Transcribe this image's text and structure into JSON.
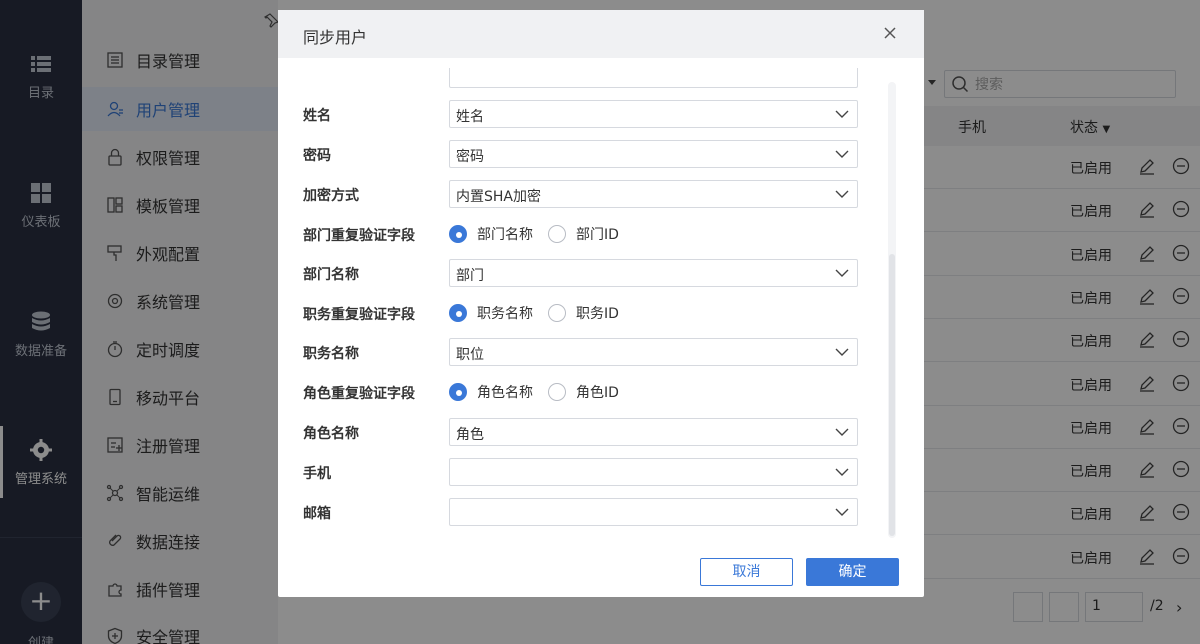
{
  "rail": {
    "items": [
      {
        "label": "目录",
        "icon": "list-icon"
      },
      {
        "label": "仪表板",
        "icon": "dashboard-icon"
      },
      {
        "label": "数据准备",
        "icon": "database-icon"
      },
      {
        "label": "管理系统",
        "icon": "gear-icon",
        "active": true
      }
    ],
    "add_label": "创建"
  },
  "menu": {
    "items": [
      {
        "label": "目录管理",
        "icon": "catalog-icon"
      },
      {
        "label": "用户管理",
        "icon": "user-icon",
        "active": true
      },
      {
        "label": "权限管理",
        "icon": "lock-icon"
      },
      {
        "label": "模板管理",
        "icon": "template-icon"
      },
      {
        "label": "外观配置",
        "icon": "brush-icon"
      },
      {
        "label": "系统管理",
        "icon": "settings-icon"
      },
      {
        "label": "定时调度",
        "icon": "timer-icon"
      },
      {
        "label": "移动平台",
        "icon": "mobile-icon"
      },
      {
        "label": "注册管理",
        "icon": "register-icon"
      },
      {
        "label": "智能运维",
        "icon": "ops-icon"
      },
      {
        "label": "数据连接",
        "icon": "link-icon"
      },
      {
        "label": "插件管理",
        "icon": "plugin-icon"
      },
      {
        "label": "安全管理",
        "icon": "shield-icon"
      }
    ]
  },
  "main": {
    "search_placeholder": "搜索",
    "columns": {
      "phone": "手机",
      "status": "状态"
    },
    "rows": [
      {
        "status": "已启用"
      },
      {
        "status": "已启用"
      },
      {
        "status": "已启用"
      },
      {
        "status": "已启用"
      },
      {
        "status": "已启用"
      },
      {
        "status": "已启用"
      },
      {
        "status": "已启用"
      },
      {
        "status": "已启用"
      },
      {
        "status": "已启用"
      },
      {
        "status": "已启用"
      }
    ],
    "pager": {
      "current": "1",
      "total": "/2"
    }
  },
  "modal": {
    "title": "同步用户",
    "fields": {
      "name": {
        "label": "姓名",
        "value": "姓名"
      },
      "password": {
        "label": "密码",
        "value": "密码"
      },
      "encrypt": {
        "label": "加密方式",
        "value": "内置SHA加密"
      },
      "dept_verify": {
        "label": "部门重复验证字段",
        "opt1": "部门名称",
        "opt2": "部门ID"
      },
      "dept_name": {
        "label": "部门名称",
        "value": "部门"
      },
      "job_verify": {
        "label": "职务重复验证字段",
        "opt1": "职务名称",
        "opt2": "职务ID"
      },
      "job_name": {
        "label": "职务名称",
        "value": "职位"
      },
      "role_verify": {
        "label": "角色重复验证字段",
        "opt1": "角色名称",
        "opt2": "角色ID"
      },
      "role_name": {
        "label": "角色名称",
        "value": "角色"
      },
      "phone": {
        "label": "手机",
        "value": ""
      },
      "email": {
        "label": "邮箱",
        "value": ""
      }
    },
    "cancel": "取消",
    "ok": "确定"
  },
  "colors": {
    "accent": "#3a78d8",
    "rail": "#2a3142"
  }
}
